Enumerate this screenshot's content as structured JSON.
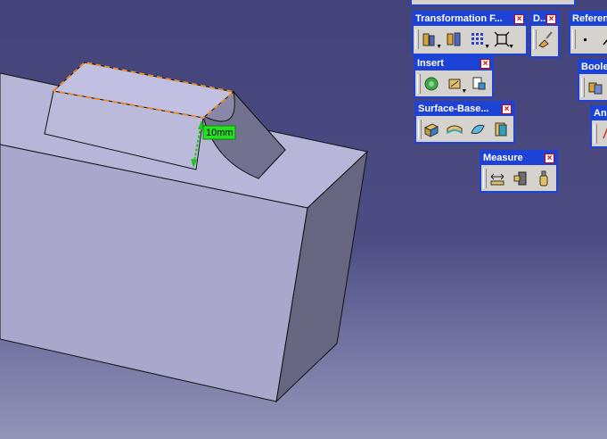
{
  "viewport": {
    "dimension_label": "10mm",
    "background_top": "#43437a",
    "background_bottom": "#9494b8"
  },
  "toolbars": {
    "transformation": {
      "title": "Transformation F...",
      "icons": [
        "translate-icon",
        "rotate-icon",
        "pattern-grid-icon",
        "scale-icon"
      ]
    },
    "draft": {
      "title": "D..",
      "icons": [
        "draft-brush-icon"
      ]
    },
    "reference": {
      "title": "Referen",
      "icons": [
        "point-icon",
        "line-icon"
      ]
    },
    "insert": {
      "title": "Insert",
      "icons": [
        "body-icon",
        "sketch-insert-icon",
        "feature-insert-icon"
      ]
    },
    "boolean": {
      "title": "Boole",
      "icons": [
        "boolean-assemble-icon"
      ]
    },
    "analysis": {
      "title": "Ana",
      "icons": [
        "analysis-icon"
      ]
    },
    "surface_based": {
      "title": "Surface-Base...",
      "icons": [
        "split-icon",
        "thick-surface-icon",
        "close-surface-icon",
        "sew-surface-icon"
      ]
    },
    "measure": {
      "title": "Measure",
      "icons": [
        "measure-between-icon",
        "measure-item-icon",
        "measure-inertia-icon"
      ]
    }
  }
}
